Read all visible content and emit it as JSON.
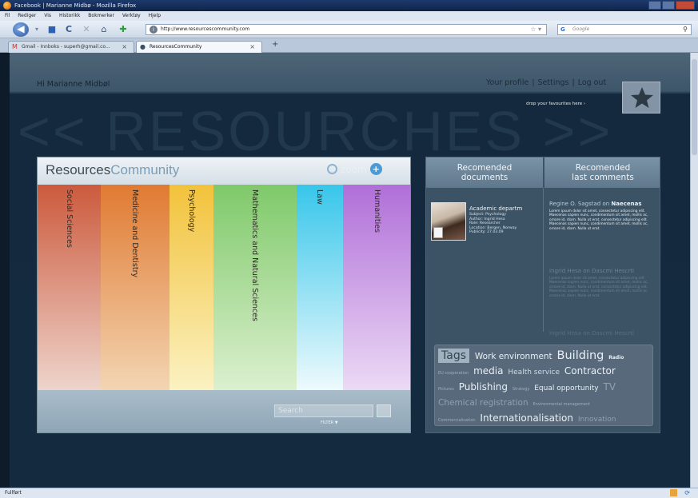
{
  "browser": {
    "window_title": "Facebook | Marianne Midbø - Mozilla Firefox",
    "menu": [
      "Fil",
      "Rediger",
      "Vis",
      "Historikk",
      "Bokmerker",
      "Verktøy",
      "Hjelp"
    ],
    "url": "http://www.resourcescommunity.com",
    "search_placeholder": "Google",
    "tabs": [
      {
        "label": "Gmail - Innboks - superh@gmail.co...",
        "active": false
      },
      {
        "label": "ResourcesCommunity",
        "active": true
      }
    ],
    "status": "Fullført"
  },
  "header": {
    "greeting": "Hi Marianne Midbøl",
    "profile_link": "Your profile",
    "settings_link": "Settings",
    "logout_link": "Log out",
    "fav_hint": "drop your favourites here ›",
    "background_word": "<< RESOURCHES >>"
  },
  "panel": {
    "logo_bold": "Resources",
    "logo_light": "Community",
    "zoom_label": "zoom",
    "columns": [
      {
        "label": "Social Sciences",
        "color_top": "#cc5a3d",
        "color_bottom": "#eed4cb"
      },
      {
        "label": "Medicine and Dentistry",
        "color_top": "#e07a32",
        "color_bottom": "#f3d5b3"
      },
      {
        "label": "Psychology",
        "color_top": "#f2c23b",
        "color_bottom": "#fbf2c2"
      },
      {
        "label": "Mathematics and Natural Sciences",
        "color_top": "#7fc96a",
        "color_bottom": "#dcf0cf"
      },
      {
        "label": "Law",
        "color_top": "#37c6ea",
        "color_bottom": "#eefafd"
      },
      {
        "label": "Humanities",
        "color_top": "#b06fd8",
        "color_bottom": "#ecdaf5"
      }
    ],
    "search_placeholder": "Search",
    "filter_label": "FILTER ▼"
  },
  "right": {
    "tab_docs": [
      "Recomended",
      "documents"
    ],
    "tab_comments": [
      "Recomended",
      "last comments"
    ],
    "document": {
      "title": "Academic departm",
      "meta": [
        "Subject: Psychology",
        "Author: Ingrid Hesa",
        "Role: Researcher",
        "Location: Bergen, Norway",
        "Publicity: 27.03.09"
      ]
    },
    "comments": [
      {
        "author": "Regine O. Sagstad",
        "on": "on",
        "target": "Naecenas",
        "body": "Lorem ipsum dolor sit amet, consectetur adipiscing elit. Maecenas sapien nunc, condimentum sit amet, mollis ac, ornare id, diam. Nulla ut erat. consectetur adipiscing elit. Maecenas sapien nunc, condimentum sit amet, mollis ac, ornare id, diam. Nulla ut erat."
      },
      {
        "author": "Ingrid Hesa",
        "on": "on",
        "target": "Dascmi Hescrtl",
        "body": "Lorem ipsum dolor sit amet, consectetur adipiscing elit. Maecenas sapien nunc, condimentum sit amet, mollis ac, ornare id, diam. Nulla ut erat. consectetur adipiscing elit. Maecenas sapien nunc, condimentum sit amet, mollis ac, ornare id, diam. Nulla ut erat."
      },
      {
        "author": "Ingrid Hesa",
        "on": "on",
        "target": "Dascmi Hescrtl",
        "body": ""
      }
    ],
    "tags_label": "Tags",
    "tags": [
      "Work environment",
      "Building",
      "Radio",
      "EU cooperation",
      "media",
      "Health service",
      "Contractor",
      "Pictures",
      "Publishing",
      "Strategy",
      "Equal opportunity",
      "TV",
      "Chemical registration",
      "Environmental management",
      "Commercialisation",
      "Internationalisation",
      "Innovation"
    ]
  }
}
